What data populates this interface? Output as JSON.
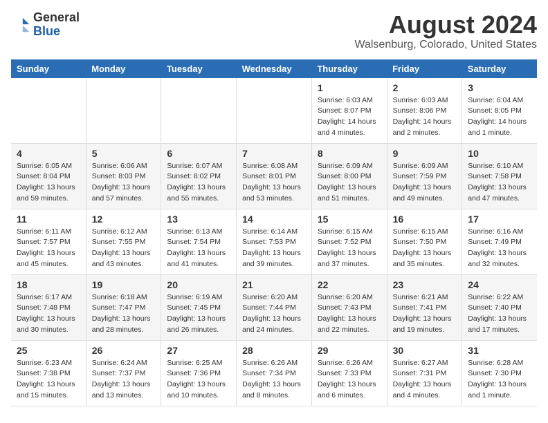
{
  "logo": {
    "general": "General",
    "blue": "Blue"
  },
  "title": "August 2024",
  "subtitle": "Walsenburg, Colorado, United States",
  "days_of_week": [
    "Sunday",
    "Monday",
    "Tuesday",
    "Wednesday",
    "Thursday",
    "Friday",
    "Saturday"
  ],
  "weeks": [
    [
      {
        "day": "",
        "info": ""
      },
      {
        "day": "",
        "info": ""
      },
      {
        "day": "",
        "info": ""
      },
      {
        "day": "",
        "info": ""
      },
      {
        "day": "1",
        "info": "Sunrise: 6:03 AM\nSunset: 8:07 PM\nDaylight: 14 hours\nand 4 minutes."
      },
      {
        "day": "2",
        "info": "Sunrise: 6:03 AM\nSunset: 8:06 PM\nDaylight: 14 hours\nand 2 minutes."
      },
      {
        "day": "3",
        "info": "Sunrise: 6:04 AM\nSunset: 8:05 PM\nDaylight: 14 hours\nand 1 minute."
      }
    ],
    [
      {
        "day": "4",
        "info": "Sunrise: 6:05 AM\nSunset: 8:04 PM\nDaylight: 13 hours\nand 59 minutes."
      },
      {
        "day": "5",
        "info": "Sunrise: 6:06 AM\nSunset: 8:03 PM\nDaylight: 13 hours\nand 57 minutes."
      },
      {
        "day": "6",
        "info": "Sunrise: 6:07 AM\nSunset: 8:02 PM\nDaylight: 13 hours\nand 55 minutes."
      },
      {
        "day": "7",
        "info": "Sunrise: 6:08 AM\nSunset: 8:01 PM\nDaylight: 13 hours\nand 53 minutes."
      },
      {
        "day": "8",
        "info": "Sunrise: 6:09 AM\nSunset: 8:00 PM\nDaylight: 13 hours\nand 51 minutes."
      },
      {
        "day": "9",
        "info": "Sunrise: 6:09 AM\nSunset: 7:59 PM\nDaylight: 13 hours\nand 49 minutes."
      },
      {
        "day": "10",
        "info": "Sunrise: 6:10 AM\nSunset: 7:58 PM\nDaylight: 13 hours\nand 47 minutes."
      }
    ],
    [
      {
        "day": "11",
        "info": "Sunrise: 6:11 AM\nSunset: 7:57 PM\nDaylight: 13 hours\nand 45 minutes."
      },
      {
        "day": "12",
        "info": "Sunrise: 6:12 AM\nSunset: 7:55 PM\nDaylight: 13 hours\nand 43 minutes."
      },
      {
        "day": "13",
        "info": "Sunrise: 6:13 AM\nSunset: 7:54 PM\nDaylight: 13 hours\nand 41 minutes."
      },
      {
        "day": "14",
        "info": "Sunrise: 6:14 AM\nSunset: 7:53 PM\nDaylight: 13 hours\nand 39 minutes."
      },
      {
        "day": "15",
        "info": "Sunrise: 6:15 AM\nSunset: 7:52 PM\nDaylight: 13 hours\nand 37 minutes."
      },
      {
        "day": "16",
        "info": "Sunrise: 6:15 AM\nSunset: 7:50 PM\nDaylight: 13 hours\nand 35 minutes."
      },
      {
        "day": "17",
        "info": "Sunrise: 6:16 AM\nSunset: 7:49 PM\nDaylight: 13 hours\nand 32 minutes."
      }
    ],
    [
      {
        "day": "18",
        "info": "Sunrise: 6:17 AM\nSunset: 7:48 PM\nDaylight: 13 hours\nand 30 minutes."
      },
      {
        "day": "19",
        "info": "Sunrise: 6:18 AM\nSunset: 7:47 PM\nDaylight: 13 hours\nand 28 minutes."
      },
      {
        "day": "20",
        "info": "Sunrise: 6:19 AM\nSunset: 7:45 PM\nDaylight: 13 hours\nand 26 minutes."
      },
      {
        "day": "21",
        "info": "Sunrise: 6:20 AM\nSunset: 7:44 PM\nDaylight: 13 hours\nand 24 minutes."
      },
      {
        "day": "22",
        "info": "Sunrise: 6:20 AM\nSunset: 7:43 PM\nDaylight: 13 hours\nand 22 minutes."
      },
      {
        "day": "23",
        "info": "Sunrise: 6:21 AM\nSunset: 7:41 PM\nDaylight: 13 hours\nand 19 minutes."
      },
      {
        "day": "24",
        "info": "Sunrise: 6:22 AM\nSunset: 7:40 PM\nDaylight: 13 hours\nand 17 minutes."
      }
    ],
    [
      {
        "day": "25",
        "info": "Sunrise: 6:23 AM\nSunset: 7:38 PM\nDaylight: 13 hours\nand 15 minutes."
      },
      {
        "day": "26",
        "info": "Sunrise: 6:24 AM\nSunset: 7:37 PM\nDaylight: 13 hours\nand 13 minutes."
      },
      {
        "day": "27",
        "info": "Sunrise: 6:25 AM\nSunset: 7:36 PM\nDaylight: 13 hours\nand 10 minutes."
      },
      {
        "day": "28",
        "info": "Sunrise: 6:26 AM\nSunset: 7:34 PM\nDaylight: 13 hours\nand 8 minutes."
      },
      {
        "day": "29",
        "info": "Sunrise: 6:26 AM\nSunset: 7:33 PM\nDaylight: 13 hours\nand 6 minutes."
      },
      {
        "day": "30",
        "info": "Sunrise: 6:27 AM\nSunset: 7:31 PM\nDaylight: 13 hours\nand 4 minutes."
      },
      {
        "day": "31",
        "info": "Sunrise: 6:28 AM\nSunset: 7:30 PM\nDaylight: 13 hours\nand 1 minute."
      }
    ]
  ]
}
